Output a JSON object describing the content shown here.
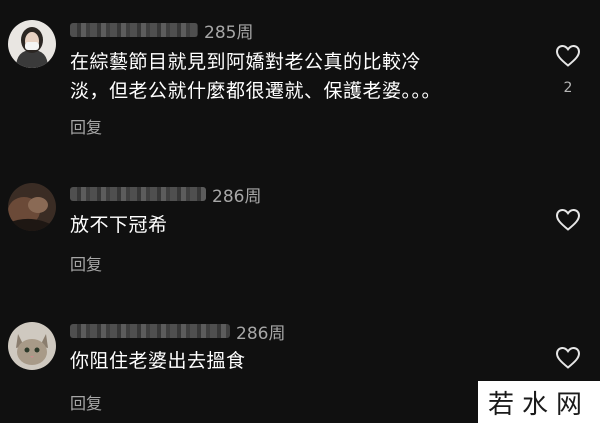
{
  "comments": [
    {
      "time": "285周",
      "text_lines": [
        "在綜藝節目就見到阿嬌對老公真的比較冷",
        "淡，但老公就什麼都很遷就、保護老婆。。。"
      ],
      "reply_label": "回复",
      "like_count": "2"
    },
    {
      "time": "286周",
      "text_lines": [
        "放不下冠希"
      ],
      "reply_label": "回复",
      "like_count": ""
    },
    {
      "time": "286周",
      "text_lines": [
        "你阻住老婆出去搵食"
      ],
      "reply_label": "回复",
      "like_count": ""
    }
  ],
  "icons": {
    "like": "heart-outline-icon"
  },
  "colors": {
    "background": "#101010",
    "muted": "#a7a7a7"
  },
  "watermark": "若水网"
}
